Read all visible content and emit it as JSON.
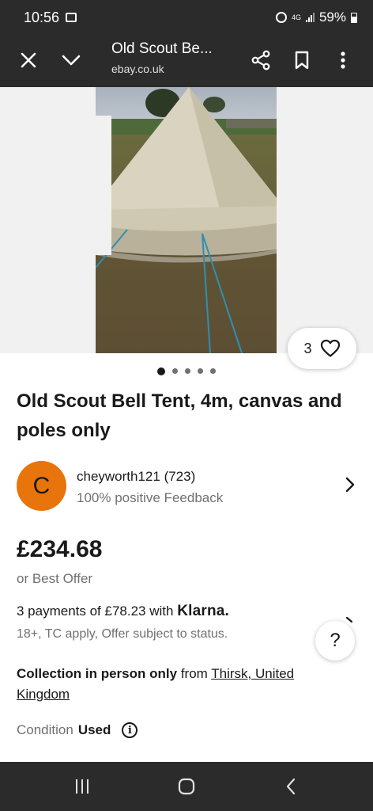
{
  "status_bar": {
    "time": "10:56",
    "network": "4G",
    "battery": "59%"
  },
  "app_bar": {
    "title": "Old Scout Be...",
    "domain": "ebay.co.uk"
  },
  "gallery": {
    "favorite_count": "3",
    "image_count": 5,
    "active_index": 0
  },
  "listing": {
    "title": "Old Scout Bell Tent, 4m, canvas and poles only",
    "seller": {
      "initial": "C",
      "name": "cheyworth121 (723)",
      "feedback": "100% positive Feedback"
    },
    "price": "£234.68",
    "best_offer": "or Best Offer",
    "klarna": {
      "text": "3 payments of £78.23 with",
      "brand": "Klarna.",
      "note": "18+, TC apply, Offer subject to status."
    },
    "collection": {
      "bold": "Collection in person only",
      "from": "from",
      "location": "Thirsk, United Kingdom"
    },
    "condition": {
      "label": "Condition",
      "value": "Used"
    }
  },
  "help_label": "?",
  "colors": {
    "bars": "#2b2b2b",
    "avatar": "#e8740c",
    "text": "#191919",
    "muted": "#707070",
    "gallery_bg": "#f1f1f1"
  }
}
